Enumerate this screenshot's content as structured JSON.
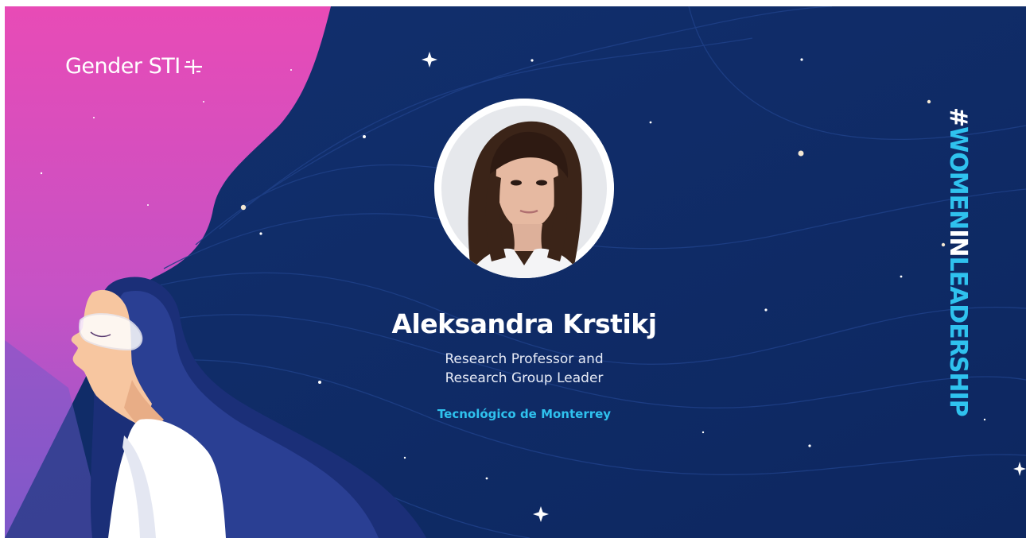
{
  "brand": {
    "text": "Gender STI",
    "icon": "plus-divider-icon"
  },
  "person": {
    "name": "Aleksandra Krstikj",
    "role_line1": "Research Professor and",
    "role_line2": "Research Group Leader",
    "organization": "Tecnológico de Monterrey"
  },
  "hashtag": {
    "hash": "#",
    "part1": "WOMEN",
    "part2": "IN",
    "part3": "LEADERSHIP"
  },
  "colors": {
    "background_navy": "#0f2b66",
    "pink": "#e64fb8",
    "accent_cyan": "#2fc2ee",
    "white": "#ffffff"
  }
}
